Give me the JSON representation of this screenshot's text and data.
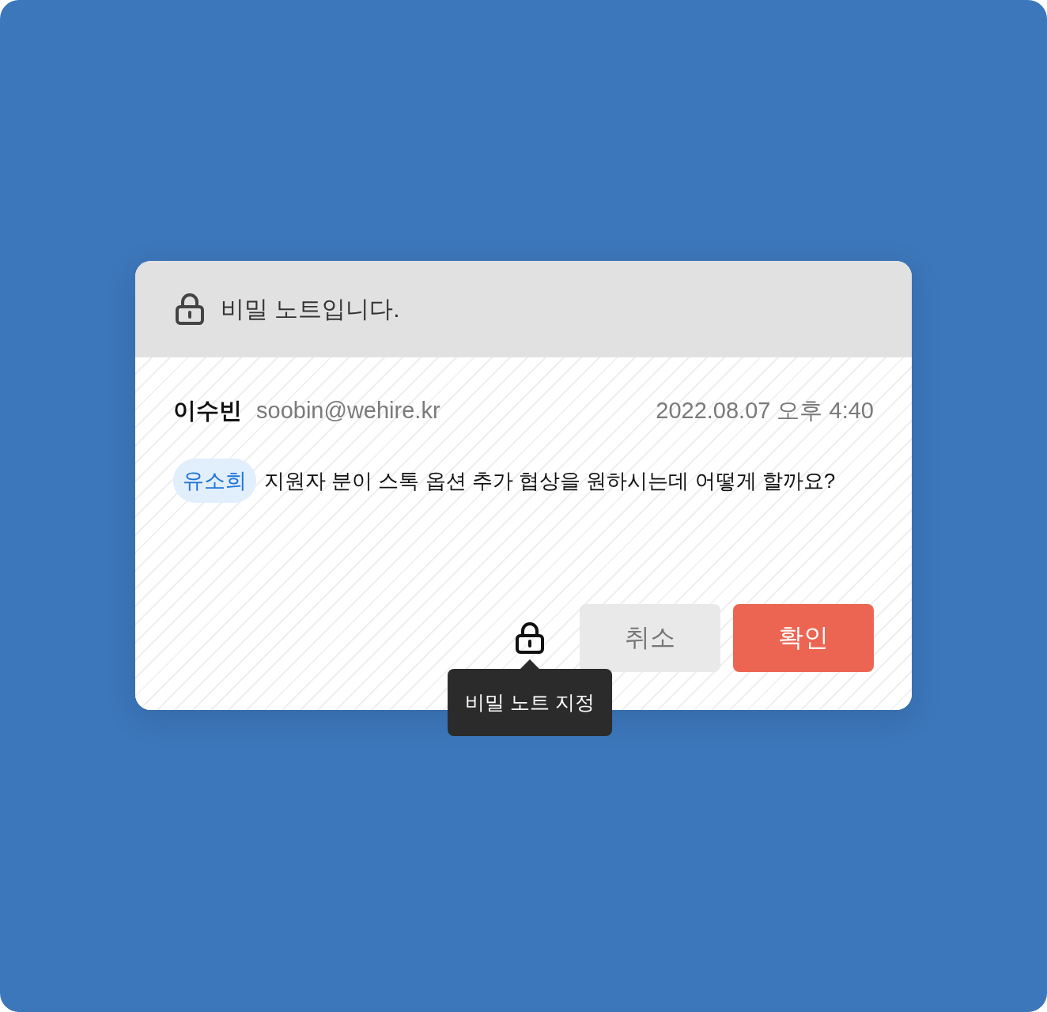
{
  "header": {
    "text": "비밀 노트입니다."
  },
  "note": {
    "author": "이수빈",
    "email": "soobin@wehire.kr",
    "timestamp": "2022.08.07 오후 4:40",
    "mention": "유소희",
    "message": "지원자 분이 스톡 옵션 추가 협상을 원하시는데 어떻게 할까요?"
  },
  "footer": {
    "tooltip": "비밀 노트 지정",
    "buttons": [
      {
        "label": "취소",
        "kind": "secondary"
      },
      {
        "label": "확인",
        "kind": "primary"
      }
    ]
  }
}
